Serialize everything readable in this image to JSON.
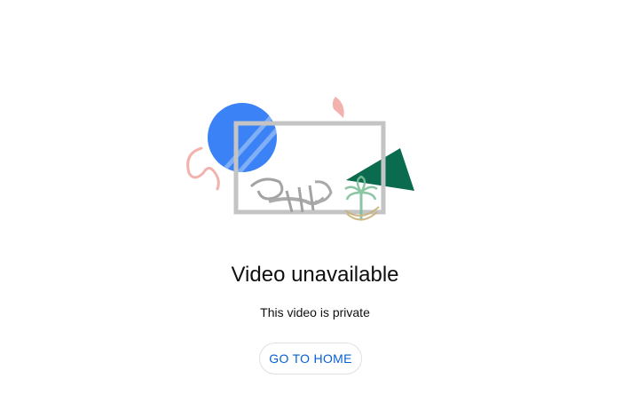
{
  "error": {
    "title": "Video unavailable",
    "message": "This video is private",
    "button_label": "GO TO HOME",
    "accent_color": "#065fd4"
  },
  "illustration": {
    "shapes": [
      "blue-circle",
      "pink-semicircle",
      "pink-squiggle",
      "green-triangle",
      "gray-frame"
    ],
    "watermark": "calligraphy-emblem"
  },
  "colors": {
    "circle": "#3b82f6",
    "triangle": "#0b6b4f",
    "pink": "#f3b2ad",
    "frame": "#c4c4c4"
  }
}
